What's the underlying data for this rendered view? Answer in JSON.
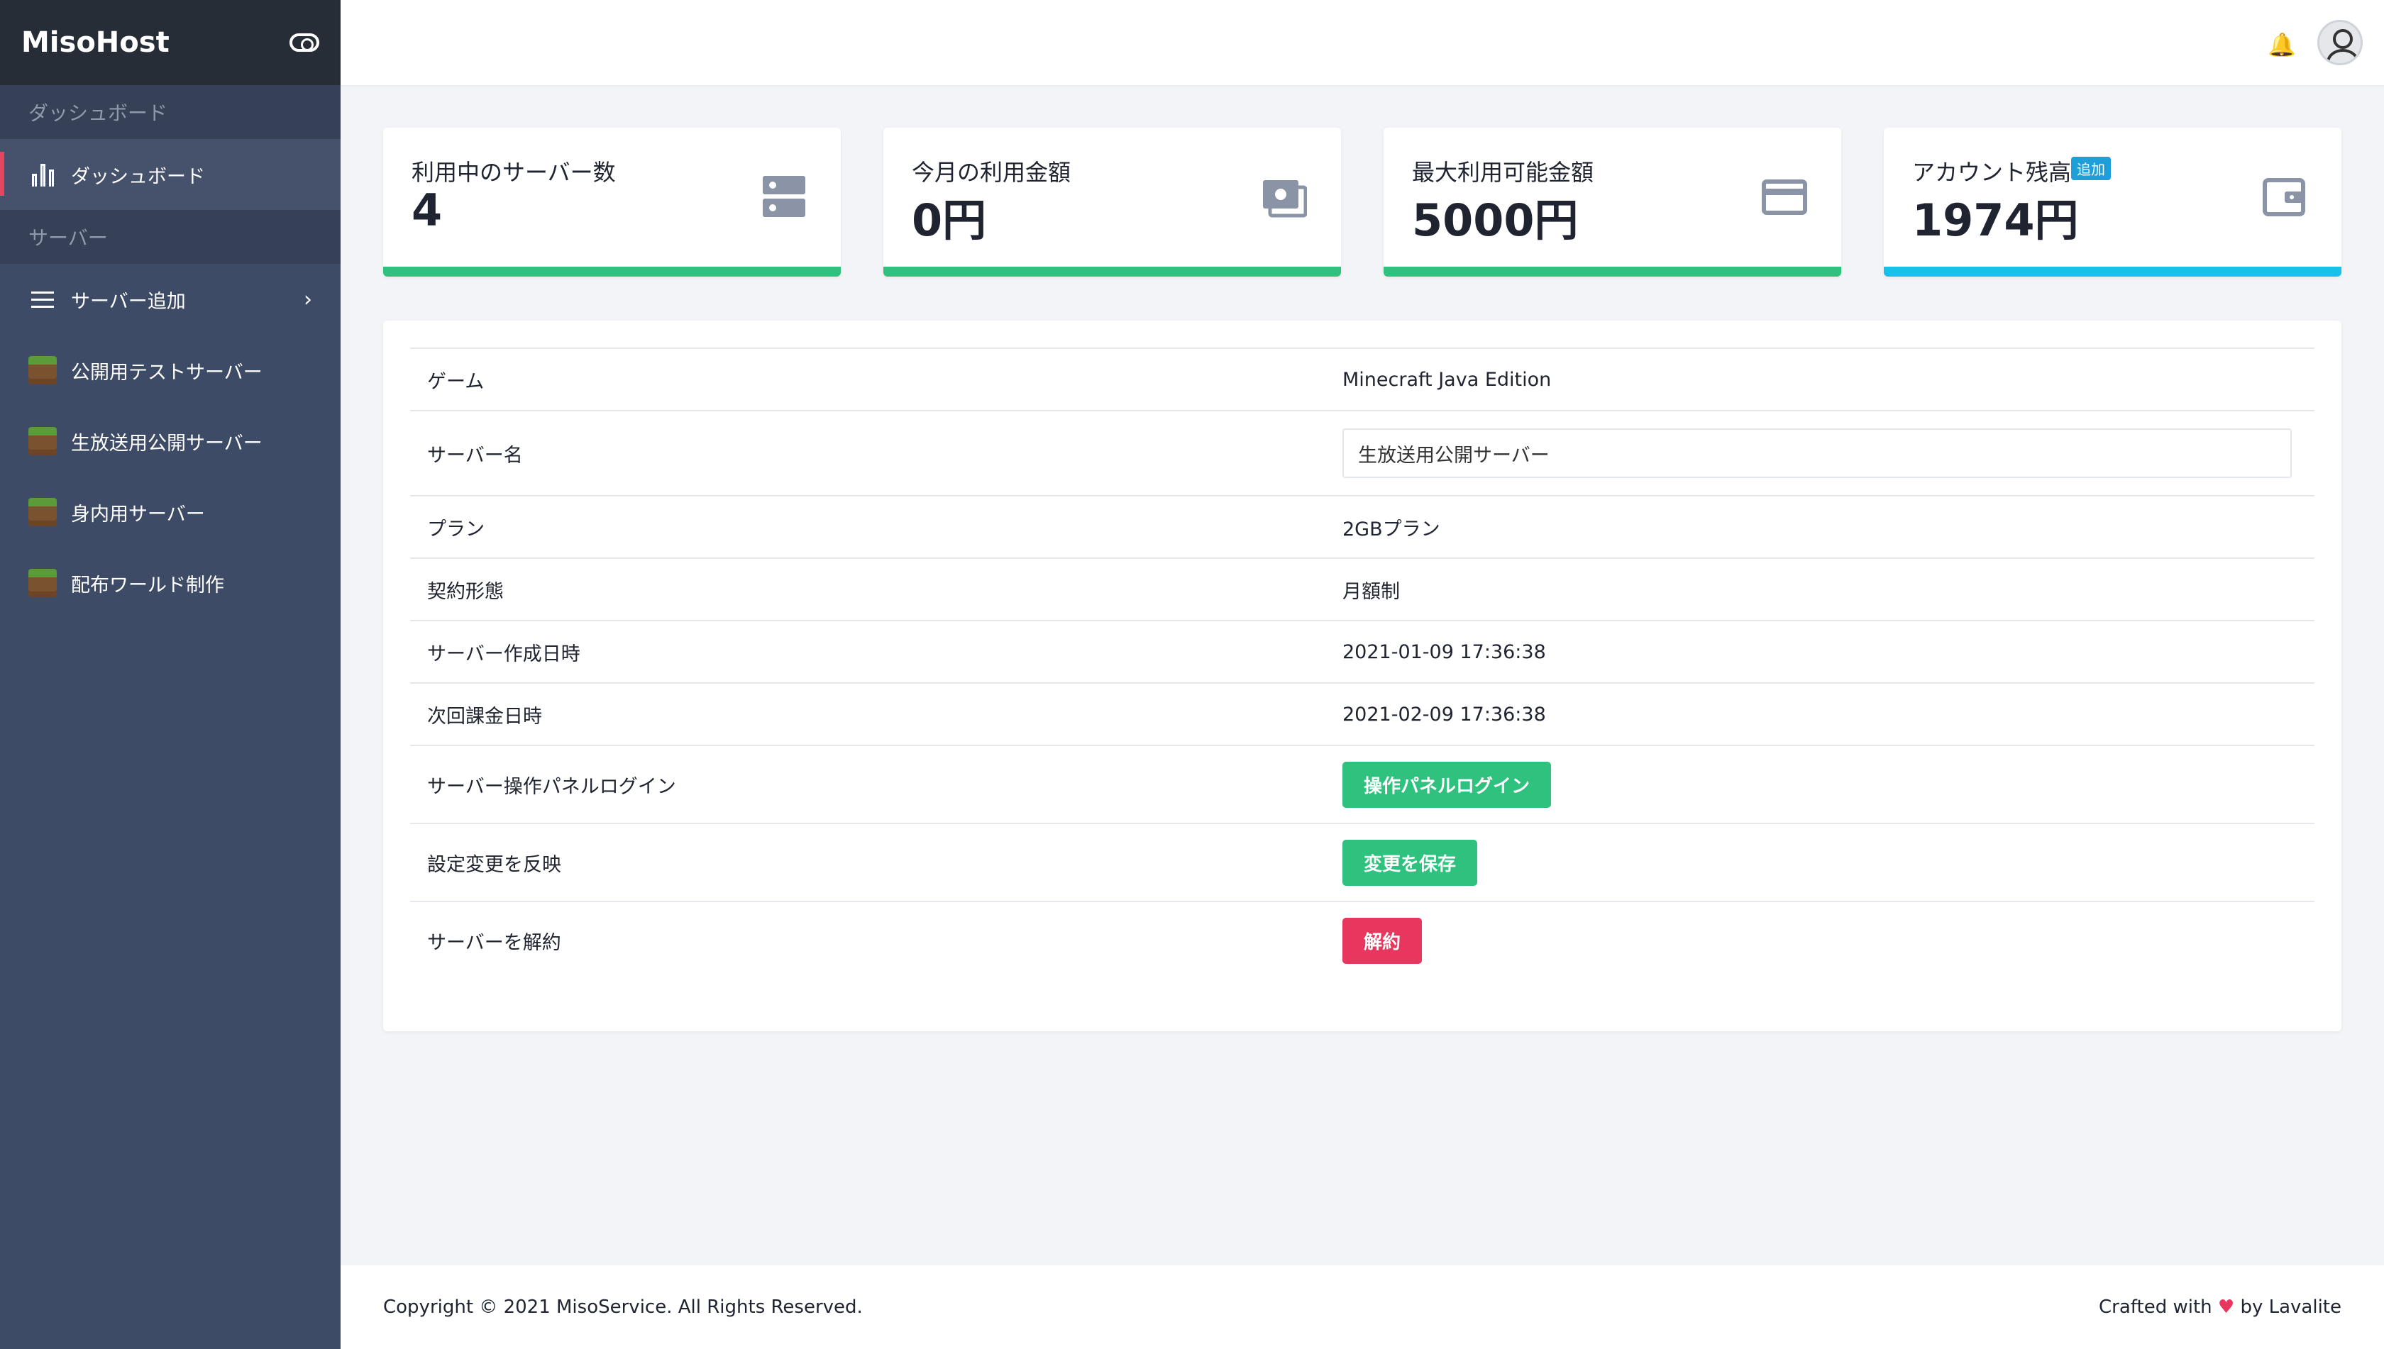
{
  "brand": {
    "name": "MisoHost"
  },
  "sidebar": {
    "section_dashboard": "ダッシュボード",
    "dashboard_item": "ダッシュボード",
    "section_server": "サーバー",
    "add_server": "サーバー追加",
    "servers": [
      {
        "label": "公開用テストサーバー"
      },
      {
        "label": "生放送用公開サーバー"
      },
      {
        "label": "身内用サーバー"
      },
      {
        "label": "配布ワールド制作"
      }
    ]
  },
  "cards": [
    {
      "label": "利用中のサーバー数",
      "value": "4",
      "color": "#2ec27e",
      "icon": "server-icon"
    },
    {
      "label": "今月の利用金額",
      "value": "0円",
      "color": "#2ec27e",
      "icon": "money-icon"
    },
    {
      "label": "最大利用可能金額",
      "value": "5000円",
      "color": "#2ec27e",
      "icon": "credit-card-icon"
    },
    {
      "label": "アカウント残高",
      "badge": "追加",
      "value": "1974円",
      "color": "#17c1e8",
      "icon": "wallet-icon"
    }
  ],
  "details": {
    "game_label": "ゲーム",
    "game_value": "Minecraft Java Edition",
    "name_label": "サーバー名",
    "name_value": "生放送用公開サーバー",
    "plan_label": "プラン",
    "plan_value": "2GBプラン",
    "contract_label": "契約形態",
    "contract_value": "月額制",
    "created_label": "サーバー作成日時",
    "created_value": "2021-01-09 17:36:38",
    "next_bill_label": "次回課金日時",
    "next_bill_value": "2021-02-09 17:36:38",
    "panel_login_label": "サーバー操作パネルログイン",
    "panel_login_button": "操作パネルログイン",
    "apply_label": "設定変更を反映",
    "apply_button": "変更を保存",
    "cancel_label": "サーバーを解約",
    "cancel_button": "解約"
  },
  "footer": {
    "copyright": "Copyright © 2021 MisoService. All Rights Reserved.",
    "crafted_prefix": "Crafted with",
    "heart": "♥",
    "crafted_suffix": "by Lavalite"
  },
  "colors": {
    "accent_green": "#2ec27e",
    "accent_cyan": "#17c1e8",
    "danger": "#e8375e",
    "sidebar": "#3e4b66"
  }
}
